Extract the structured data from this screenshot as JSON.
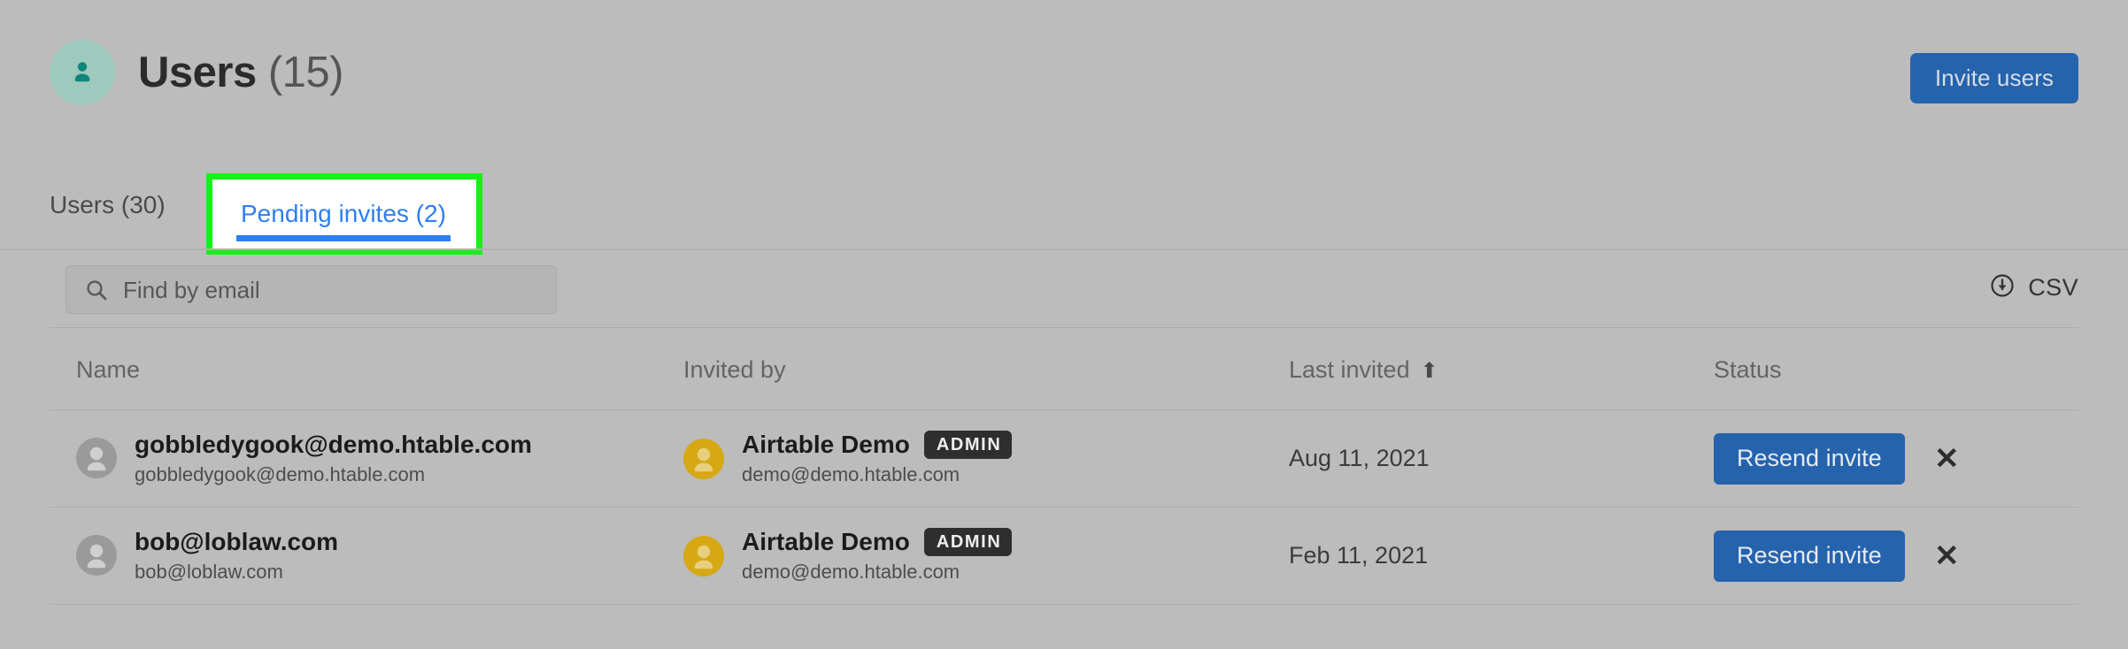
{
  "header": {
    "avatar_icon": "user-avatar-icon",
    "title": "Users",
    "count": "(15)",
    "invite_button_label": "Invite users",
    "accent_blue": "#2563ad",
    "avatar_bg": "#9ec9bd"
  },
  "tabs": [
    {
      "label": "Users (30)",
      "active": false
    },
    {
      "label": "Pending invites (2)",
      "active": true
    }
  ],
  "highlight": {
    "color": "#15f215",
    "target": "Pending invites (2)"
  },
  "toolbar": {
    "search_placeholder": "Find by email",
    "search_value": "",
    "search_icon": "search-icon",
    "csv_label": "CSV",
    "csv_icon": "download-circle-icon"
  },
  "table": {
    "columns": [
      {
        "key": "name",
        "label": "Name",
        "sorted": false
      },
      {
        "key": "invited_by",
        "label": "Invited by",
        "sorted": false
      },
      {
        "key": "last_invited",
        "label": "Last invited",
        "sorted": true,
        "sort_arrow": "⬆"
      },
      {
        "key": "status",
        "label": "Status",
        "sorted": false
      }
    ],
    "rows": [
      {
        "name": "gobbledygook@demo.htable.com",
        "email": "gobbledygook@demo.htable.com",
        "invited_by_name": "Airtable Demo",
        "invited_by_email": "demo@demo.htable.com",
        "invited_by_badge": "ADMIN",
        "last_invited": "Aug 11, 2021",
        "status_action": "Resend invite",
        "remove_icon": "✕"
      },
      {
        "name": "bob@loblaw.com",
        "email": "bob@loblaw.com",
        "invited_by_name": "Airtable Demo",
        "invited_by_email": "demo@demo.htable.com",
        "invited_by_badge": "ADMIN",
        "last_invited": "Feb 11, 2021",
        "status_action": "Resend invite",
        "remove_icon": "✕"
      }
    ]
  }
}
